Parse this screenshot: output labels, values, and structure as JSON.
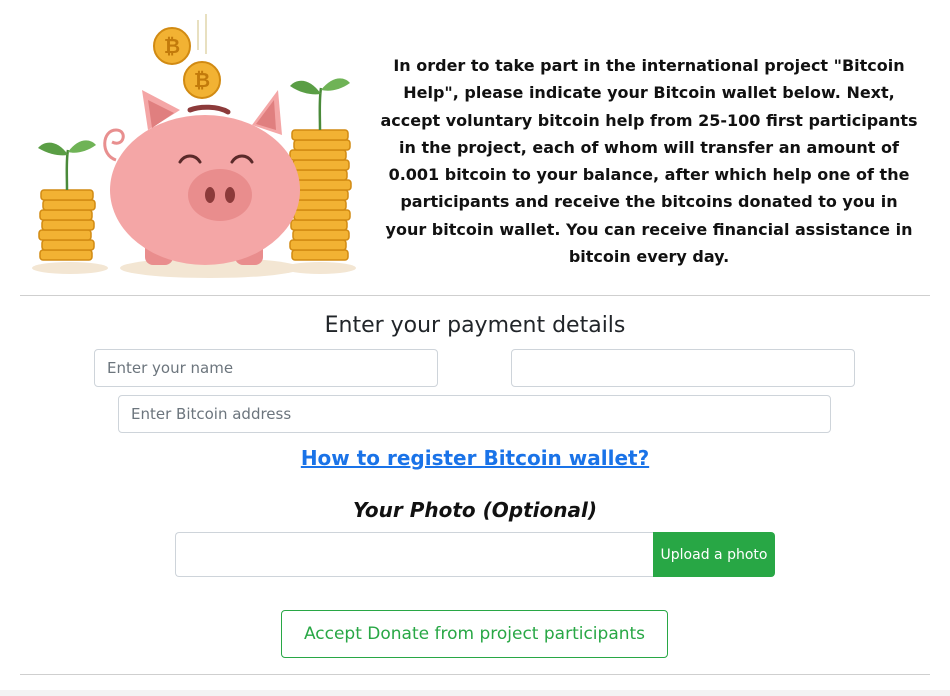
{
  "intro": {
    "text": "In order to take part in the international project \"Bitcoin Help\", please indicate your Bitcoin wallet below. Next, accept voluntary bitcoin help from 25-100 first participants in the project, each of whom will transfer an amount of 0.001 bitcoin to your balance, after which help one of the participants and receive the bitcoins donated to you in your bitcoin wallet. You can receive financial assistance in bitcoin every day."
  },
  "form": {
    "title": "Enter your payment details",
    "name_placeholder": "Enter your name",
    "name_value": "",
    "email_value": "",
    "btc_placeholder": "Enter Bitcoin address",
    "btc_value": ""
  },
  "help_link": "How to register Bitcoin wallet?",
  "photo": {
    "title": "Your Photo (Optional)",
    "upload_label": "Upload a photo"
  },
  "accept_button": "Accept Donate from project participants",
  "colors": {
    "accent_green": "#28a745",
    "link_blue": "#1a73e8",
    "coin_gold": "#f2b233",
    "piggy_pink": "#f4a6a6"
  },
  "icons": {
    "illustration": "piggy-bank-bitcoin-illustration"
  }
}
